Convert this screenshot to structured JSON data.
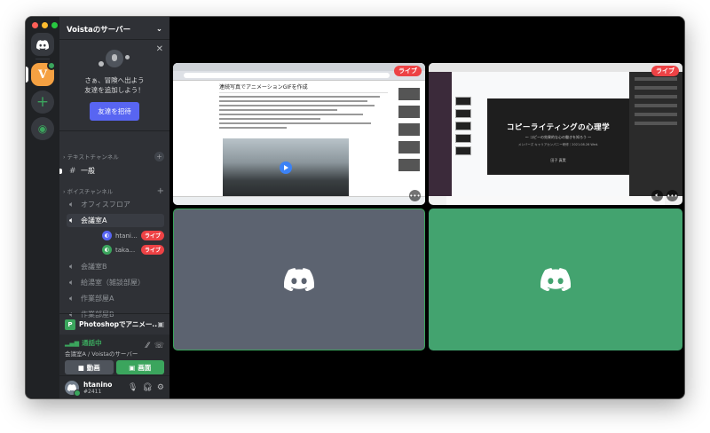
{
  "server": {
    "name": "Voistaのサーバー",
    "icon_letter": "V"
  },
  "invite": {
    "text_line1": "さぁ、冒険へ出よう",
    "text_line2": "友達を追加しよう！",
    "button": "友達を招待"
  },
  "categories": {
    "text": "テキストチャンネル",
    "voice": "ボイスチャンネル"
  },
  "text_channels": [
    {
      "label": "一般"
    }
  ],
  "voice_channels": [
    {
      "label": "オフィスフロア"
    },
    {
      "label": "会議室A"
    },
    {
      "label": "会議室B"
    },
    {
      "label": "給湯室（雑談部屋）"
    },
    {
      "label": "作業部屋A"
    },
    {
      "label": "作業部屋B"
    }
  ],
  "voice_users": [
    {
      "name": "htanino",
      "badge": "ライブ",
      "color": "#5865f2"
    },
    {
      "name": "takahiromash...",
      "badge": "ライブ",
      "color": "#3ba55d"
    }
  ],
  "activity": {
    "icon_letter": "P",
    "text": "Photoshopでアニメー..."
  },
  "voice_status": {
    "status": "通話中",
    "location": "会議室A / Voistaのサーバー",
    "video_btn": "動画",
    "screen_btn": "画面"
  },
  "user": {
    "name": "htanino",
    "tag": "#2411"
  },
  "streams": {
    "live_label": "ライブ",
    "article_title": "連続写真でアニメーションGIFを作成",
    "slide_title": "コピーライティングの心理学",
    "slide_subtitle": "〜 コピーの効果的な心の働きを知ろう 〜",
    "slide_meta": "メンバーズ キャリアカンパニー研修｜2021.08.26 Wed.",
    "slide_author": "田子 真実"
  },
  "colors": {
    "accent": "#5865f2",
    "green": "#3ba55d",
    "live": "#ed4245",
    "rail": "#202225",
    "sidebar": "#2f3136"
  }
}
